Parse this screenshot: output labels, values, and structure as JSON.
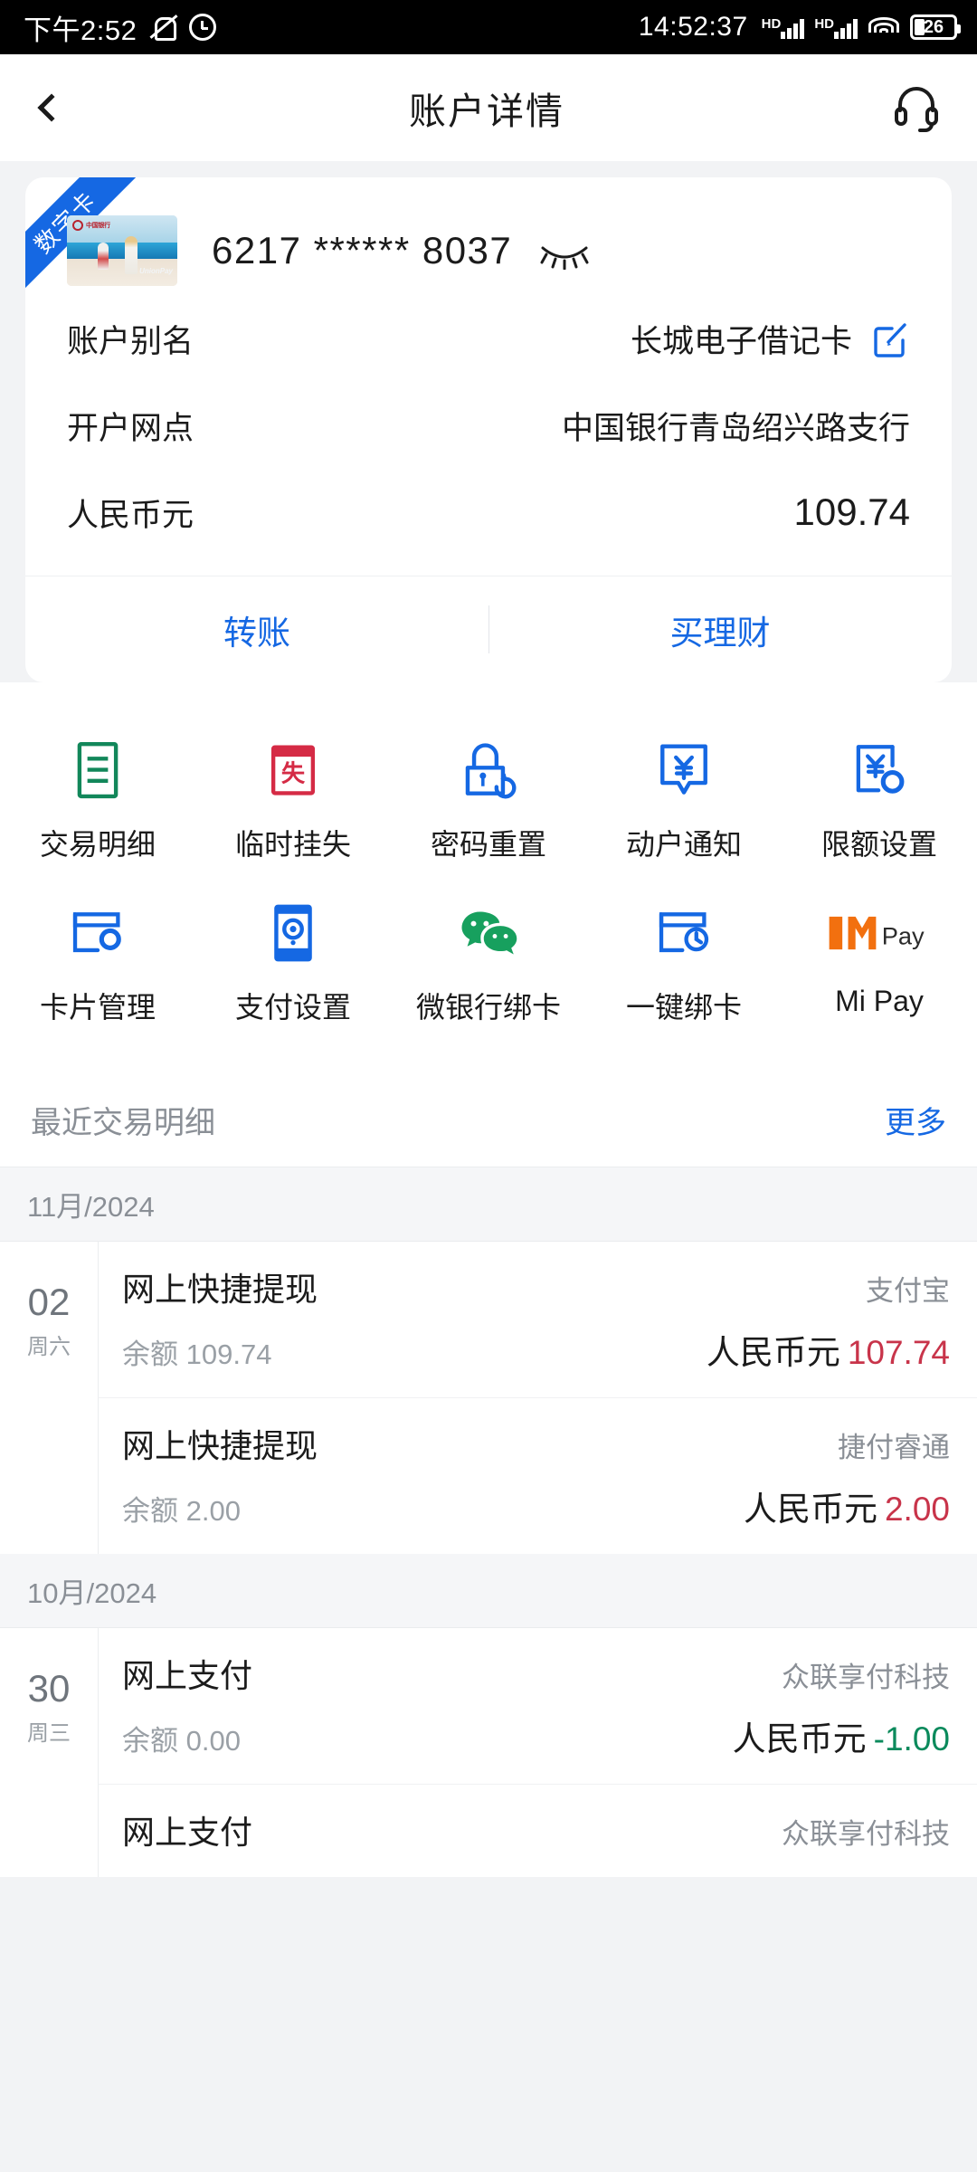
{
  "statusbar": {
    "left_time": "下午2:52",
    "mute_icon": "mute-icon",
    "alarm_icon": "alarm-clock-icon",
    "clock": "14:52:37",
    "hd1": "HD",
    "hd2": "HD",
    "wifi_icon": "wifi-icon",
    "battery_level": "26"
  },
  "header": {
    "back_icon": "back-chevron-icon",
    "title": "账户详情",
    "support_icon": "headset-icon"
  },
  "card": {
    "ribbon": "数字卡",
    "thumbnail_bank": "中国银行",
    "thumbnail_network": "UnionPay",
    "number": "6217 ****** 8037",
    "eye_icon": "eye-closed-icon",
    "rows": [
      {
        "label": "账户别名",
        "value": "长城电子借记卡",
        "edit_icon": "edit-pencil-icon"
      },
      {
        "label": "开户网点",
        "value": "中国银行青岛绍兴路支行"
      },
      {
        "label": "人民币元",
        "value": "109.74"
      }
    ],
    "actions": [
      {
        "label": "转账"
      },
      {
        "label": "买理财"
      }
    ]
  },
  "functions": [
    [
      {
        "label": "交易明细",
        "icon": "list-document-icon",
        "color": "#12875a"
      },
      {
        "label": "临时挂失",
        "icon": "lost-card-icon",
        "color": "#d52b45"
      },
      {
        "label": "密码重置",
        "icon": "lock-reset-icon",
        "color": "#1568e3"
      },
      {
        "label": "动户通知",
        "icon": "yuan-notification-icon",
        "color": "#1568e3"
      },
      {
        "label": "限额设置",
        "icon": "yuan-limit-settings-icon",
        "color": "#1568e3"
      }
    ],
    [
      {
        "label": "卡片管理",
        "icon": "card-settings-icon",
        "color": "#1568e3"
      },
      {
        "label": "支付设置",
        "icon": "payment-settings-icon",
        "color": "#1568e3"
      },
      {
        "label": "微银行绑卡",
        "icon": "wechat-icon",
        "color": "#17a05e"
      },
      {
        "label": "一键绑卡",
        "icon": "card-bind-icon",
        "color": "#1568e3"
      },
      {
        "label": "Mi Pay",
        "icon": "mi-pay-icon",
        "color": "#f2700f",
        "badge": "Pay"
      }
    ]
  ],
  "transactions": {
    "title": "最近交易明细",
    "more": "更多",
    "groups": [
      {
        "month": "11月/2024",
        "items": [
          {
            "day": "02",
            "weekday": "周六",
            "title": "网上快捷提现",
            "balance": "余额 109.74",
            "channel": "支付宝",
            "currency": "人民币元",
            "amount": "107.74",
            "sign": "neg"
          },
          {
            "day": "",
            "weekday": "",
            "title": "网上快捷提现",
            "balance": "余额 2.00",
            "channel": "捷付睿通",
            "currency": "人民币元",
            "amount": "2.00",
            "sign": "neg"
          }
        ]
      },
      {
        "month": "10月/2024",
        "items": [
          {
            "day": "30",
            "weekday": "周三",
            "title": "网上支付",
            "balance": "余额 0.00",
            "channel": "众联享付科技",
            "currency": "人民币元",
            "amount": "-1.00",
            "sign": "pos"
          },
          {
            "day": "",
            "weekday": "",
            "title": "网上支付",
            "balance": "",
            "channel": "众联享付科技",
            "currency": "",
            "amount": "",
            "sign": "neg"
          }
        ]
      }
    ]
  }
}
